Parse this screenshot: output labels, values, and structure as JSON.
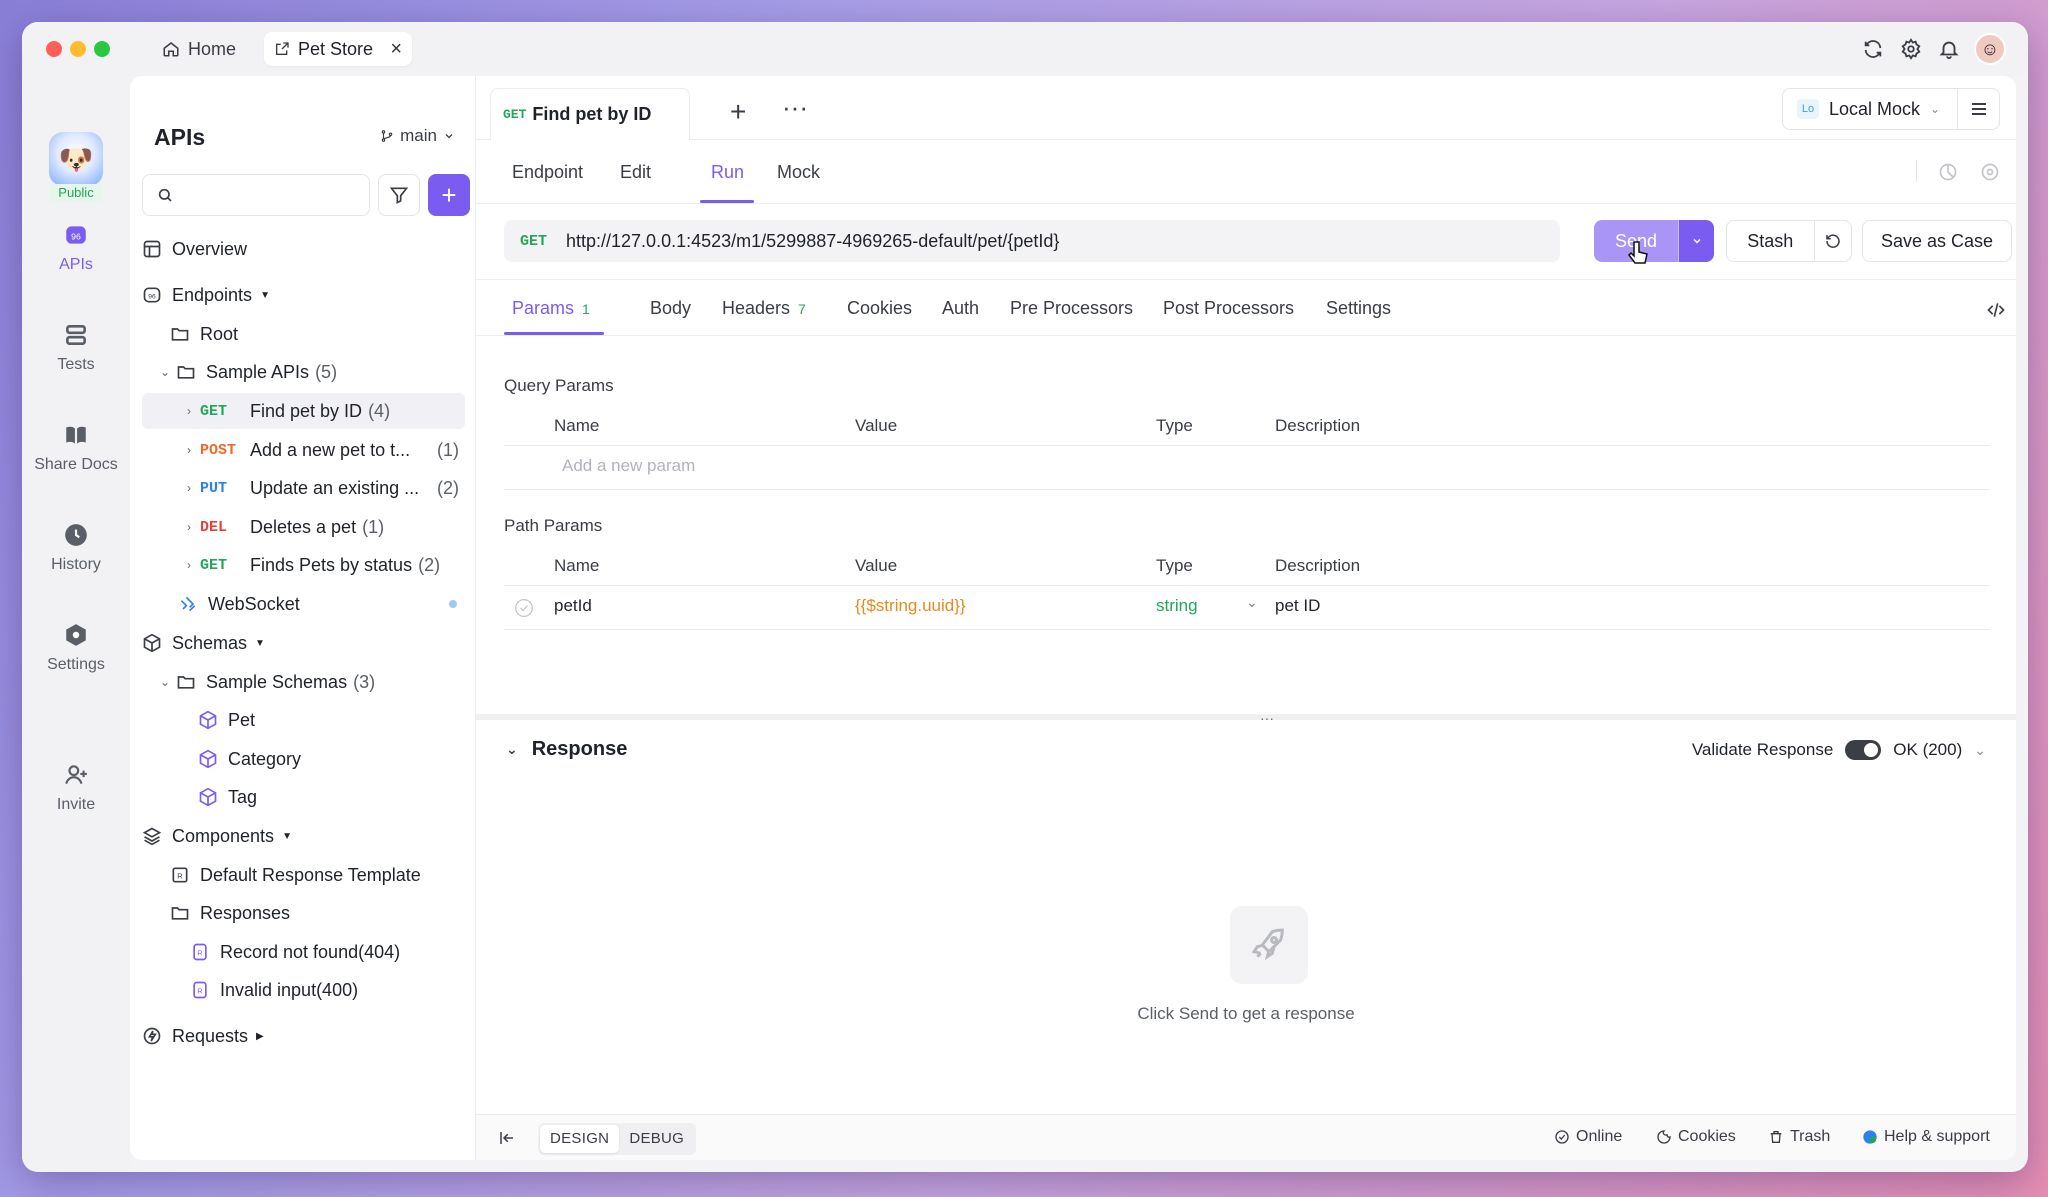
{
  "titlebar": {
    "home_tab": "Home",
    "active_tab": "Pet Store",
    "close_glyph": "×"
  },
  "rail": {
    "public_badge": "Public",
    "items": [
      {
        "label": "APIs",
        "icon": "apis-icon"
      },
      {
        "label": "Tests",
        "icon": "tests-icon"
      },
      {
        "label": "Share Docs",
        "icon": "share-docs-icon"
      },
      {
        "label": "History",
        "icon": "history-icon"
      },
      {
        "label": "Settings",
        "icon": "settings-icon"
      },
      {
        "label": "Invite",
        "icon": "invite-icon"
      }
    ]
  },
  "sidebar": {
    "title": "APIs",
    "branch": "main",
    "search_placeholder": "",
    "add_glyph": "+",
    "overview": "Overview",
    "endpoints": "Endpoints",
    "root": "Root",
    "folder": {
      "label": "Sample APIs",
      "count": "(5)"
    },
    "apis": [
      {
        "method": "GET",
        "label": "Find pet by ID",
        "count": "(4)"
      },
      {
        "method": "POST",
        "label": "Add a new pet to t...",
        "count": "(1)"
      },
      {
        "method": "PUT",
        "label": "Update an existing ...",
        "count": "(2)"
      },
      {
        "method": "DEL",
        "label": "Deletes a pet",
        "count": "(1)"
      },
      {
        "method": "GET",
        "label": "Finds Pets by status",
        "count": "(2)"
      }
    ],
    "websocket": "WebSocket",
    "schemas": "Schemas",
    "schema_folder": {
      "label": "Sample Schemas",
      "count": "(3)"
    },
    "schema_items": [
      "Pet",
      "Category",
      "Tag"
    ],
    "components": "Components",
    "default_response": "Default Response Template",
    "responses": "Responses",
    "response_items": [
      "Record not found(404)",
      "Invalid input(400)"
    ],
    "requests": "Requests"
  },
  "main": {
    "doc_tab": {
      "method": "GET",
      "title": "Find pet by ID"
    },
    "doc_plus": "+",
    "doc_more": "···",
    "environment": {
      "badge": "Lo",
      "name": "Local Mock"
    },
    "sub_tabs": [
      "Endpoint",
      "Edit",
      "Run",
      "Mock"
    ],
    "active_sub_tab": "Run",
    "request": {
      "method": "GET",
      "url": "http://127.0.0.1:4523/m1/5299887-4969265-default/pet/{petId}",
      "send": "Send",
      "stash": "Stash",
      "save_case": "Save as Case"
    },
    "req_tabs": [
      {
        "label": "Params",
        "count": "1"
      },
      {
        "label": "Body",
        "count": ""
      },
      {
        "label": "Headers",
        "count": "7"
      },
      {
        "label": "Cookies",
        "count": ""
      },
      {
        "label": "Auth",
        "count": ""
      },
      {
        "label": "Pre Processors",
        "count": ""
      },
      {
        "label": "Post Processors",
        "count": ""
      },
      {
        "label": "Settings",
        "count": ""
      }
    ],
    "query_params": {
      "label": "Query Params",
      "headers": [
        "Name",
        "Value",
        "Type",
        "Description"
      ],
      "placeholder": "Add a new param"
    },
    "path_params": {
      "label": "Path Params",
      "headers": [
        "Name",
        "Value",
        "Type",
        "Description"
      ],
      "rows": [
        {
          "name": "petId",
          "value": "{{$string.uuid}}",
          "type": "string",
          "description": "pet ID"
        }
      ]
    },
    "response": {
      "title": "Response",
      "validate": "Validate Response",
      "status": "OK (200)",
      "hint": "Click Send to get a response"
    }
  },
  "footer": {
    "design": "DESIGN",
    "debug": "DEBUG",
    "online": "Online",
    "cookies": "Cookies",
    "trash": "Trash",
    "help": "Help & support"
  },
  "colors": {
    "accent": "#7b5cf0",
    "get": "#23a55a",
    "post": "#ef6a2a",
    "put": "#2f80ed",
    "del": "#e0443a"
  }
}
